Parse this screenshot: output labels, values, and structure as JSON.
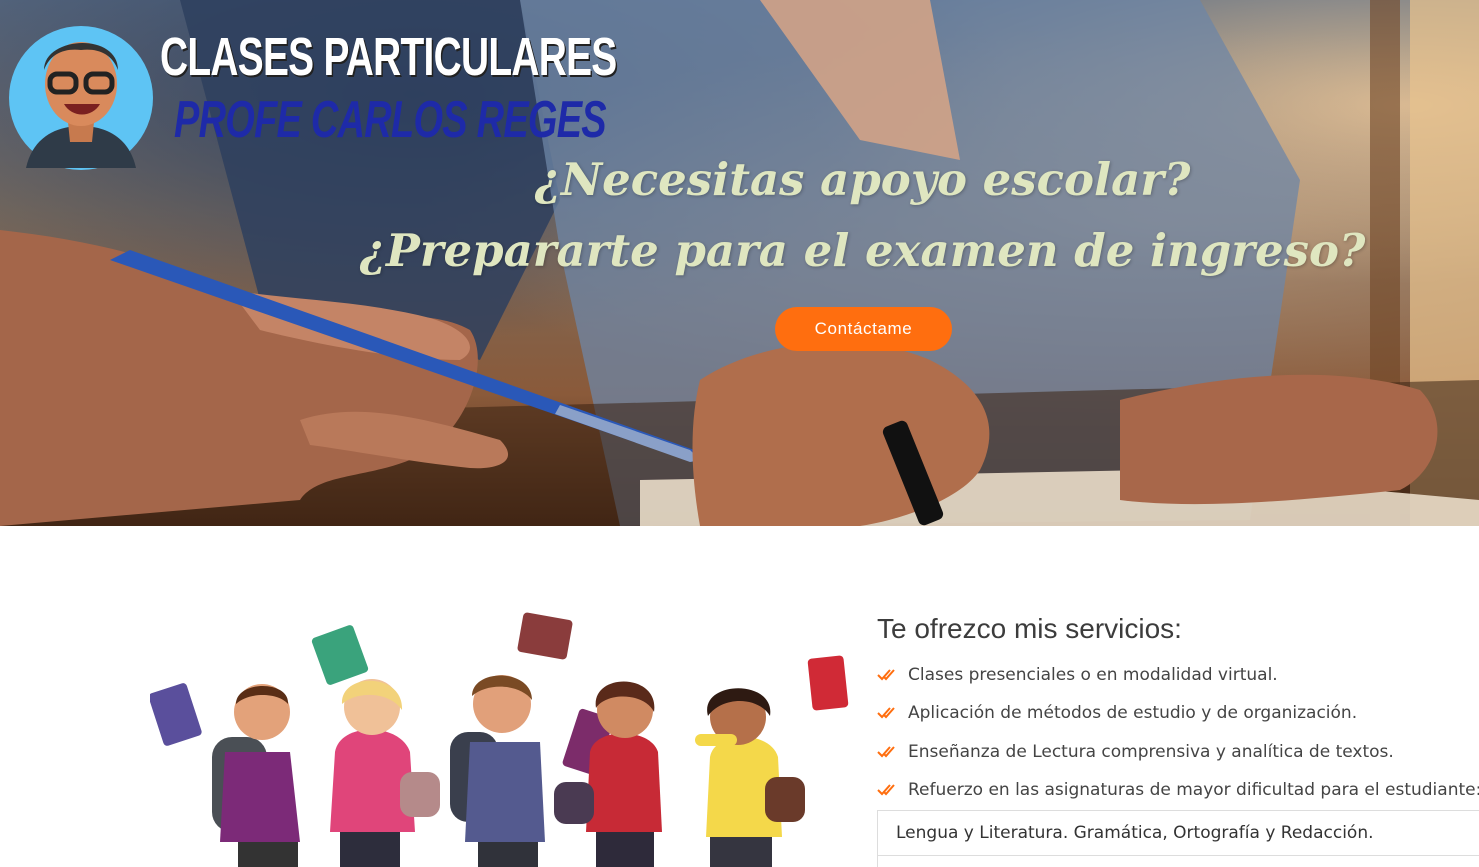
{
  "logo": {
    "line1": "CLASES PARTICULARES",
    "line2": "PROFE CARLOS REGES",
    "avatar_icon": "teacher-avatar-icon"
  },
  "hero": {
    "headline_1": "¿Necesitas apoyo escolar?",
    "headline_2": "¿Prepararte para el examen de ingreso?",
    "cta_label": "Contáctame"
  },
  "services": {
    "title": "Te ofrezco mis servicios:",
    "check_icon": "double-check-icon",
    "items": [
      "Clases presenciales o en modalidad virtual.",
      "Aplicación de métodos de estudio y de organización.",
      "Enseñanza de Lectura comprensiva y analítica de textos.",
      "Refuerzo en las asignaturas de mayor dificultad para el estudiante:"
    ],
    "subjects": [
      "Lengua y Literatura. Gramática, Ortografía y Redacción."
    ]
  },
  "colors": {
    "accent": "#ff6e0f",
    "headline": "#dfe6c0",
    "logo_blue": "#1e2aa8"
  }
}
